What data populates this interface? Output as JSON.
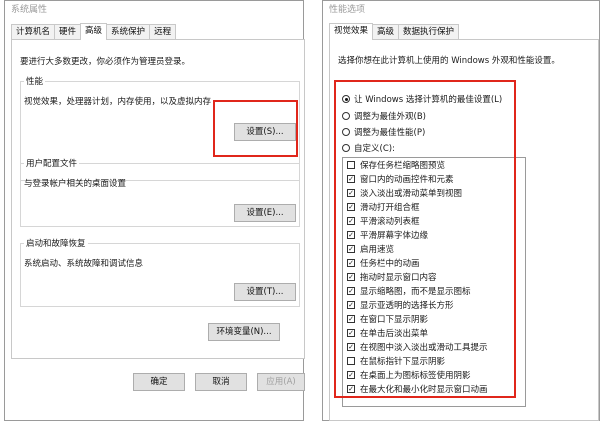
{
  "left_window": {
    "title": "系统属性",
    "tabs": [
      "计算机名",
      "硬件",
      "高级",
      "系统保护",
      "远程"
    ],
    "admin_note": "要进行大多数更改，你必须作为管理员登录。",
    "performance": {
      "label": "性能",
      "desc": "视觉效果，处理器计划，内存使用，以及虚拟内存",
      "button": "设置(S)..."
    },
    "profiles": {
      "label": "用户配置文件",
      "desc": "与登录帐户相关的桌面设置",
      "button": "设置(E)..."
    },
    "startup": {
      "label": "启动和故障恢复",
      "desc": "系统启动、系统故障和调试信息",
      "button": "设置(T)..."
    },
    "env_button": "环境变量(N)...",
    "ok": "确定",
    "cancel": "取消",
    "apply": "应用(A)"
  },
  "right_window": {
    "title": "性能选项",
    "tabs": [
      "视觉效果",
      "高级",
      "数据执行保护"
    ],
    "desc": "选择你想在此计算机上使用的 Windows 外观和性能设置。",
    "radios": [
      {
        "label": "让 Windows 选择计算机的最佳设置(L)",
        "checked": true
      },
      {
        "label": "调整为最佳外观(B)",
        "checked": false
      },
      {
        "label": "调整为最佳性能(P)",
        "checked": false
      },
      {
        "label": "自定义(C):",
        "checked": false
      }
    ],
    "options": [
      {
        "label": "保存任务栏缩略图预览",
        "checked": false
      },
      {
        "label": "窗口内的动画控件和元素",
        "checked": true
      },
      {
        "label": "淡入淡出或滑动菜单到视图",
        "checked": true
      },
      {
        "label": "滑动打开组合框",
        "checked": true
      },
      {
        "label": "平滑滚动列表框",
        "checked": true
      },
      {
        "label": "平滑屏幕字体边缘",
        "checked": true
      },
      {
        "label": "启用速览",
        "checked": true
      },
      {
        "label": "任务栏中的动画",
        "checked": true
      },
      {
        "label": "拖动时显示窗口内容",
        "checked": true
      },
      {
        "label": "显示缩略图，而不是显示图标",
        "checked": true
      },
      {
        "label": "显示亚透明的选择长方形",
        "checked": true
      },
      {
        "label": "在窗口下显示阴影",
        "checked": true
      },
      {
        "label": "在单击后淡出菜单",
        "checked": true
      },
      {
        "label": "在视图中淡入淡出或滑动工具提示",
        "checked": true
      },
      {
        "label": "在鼠标指针下显示阴影",
        "checked": false
      },
      {
        "label": "在桌面上为图标标签使用阴影",
        "checked": true
      },
      {
        "label": "在最大化和最小化时显示窗口动画",
        "checked": true
      }
    ]
  },
  "colors": {
    "highlight": "#e0261b",
    "border": "#9a9a9a"
  }
}
